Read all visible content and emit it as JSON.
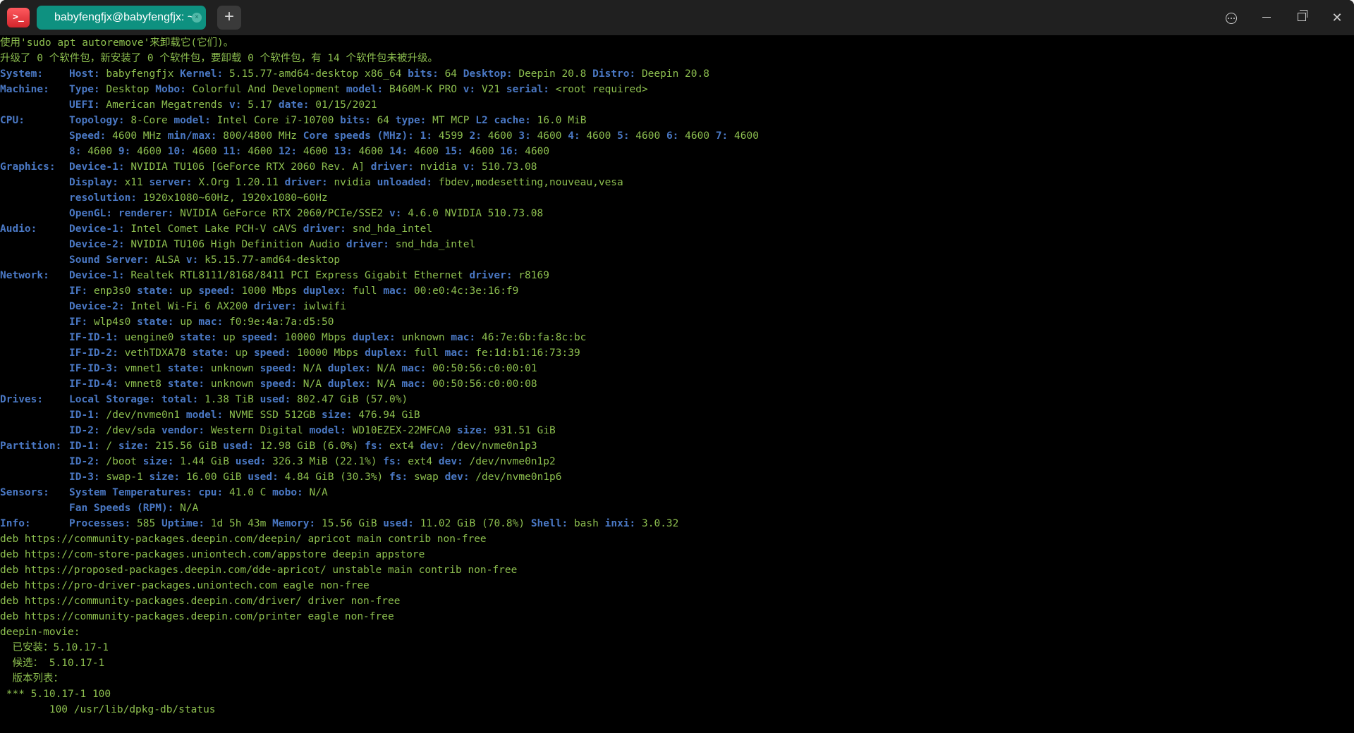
{
  "window": {
    "tab_title": "babyfengfjx@babyfengfjx: ~",
    "tab_close": "×",
    "new_tab": "+",
    "app_icon": ">_"
  },
  "terminal": {
    "pre": [
      "使用'sudo apt autoremove'来卸载它(它们)。",
      "升级了 0 个软件包，新安装了 0 个软件包，要卸载 0 个软件包，有 14 个软件包未被升级。"
    ],
    "sections": [
      {
        "label": "System:",
        "lines": [
          [
            [
              "Host:",
              "babyfengfjx"
            ],
            [
              "Kernel:",
              "5.15.77-amd64-desktop x86_64"
            ],
            [
              "bits:",
              "64"
            ],
            [
              "Desktop:",
              "Deepin 20.8"
            ],
            [
              "Distro:",
              "Deepin 20.8"
            ]
          ]
        ]
      },
      {
        "label": "Machine:",
        "lines": [
          [
            [
              "Type:",
              "Desktop"
            ],
            [
              "Mobo:",
              "Colorful And Development"
            ],
            [
              "model:",
              "B460M-K PRO"
            ],
            [
              "v:",
              "V21"
            ],
            [
              "serial:",
              "<root required>"
            ]
          ],
          [
            [
              "UEFI:",
              "American Megatrends"
            ],
            [
              "v:",
              "5.17"
            ],
            [
              "date:",
              "01/15/2021"
            ]
          ]
        ]
      },
      {
        "label": "CPU:",
        "lines": [
          [
            [
              "Topology:",
              "8-Core"
            ],
            [
              "model:",
              "Intel Core i7-10700"
            ],
            [
              "bits:",
              "64"
            ],
            [
              "type:",
              "MT MCP"
            ],
            [
              "L2 cache:",
              "16.0 MiB"
            ]
          ],
          [
            [
              "Speed:",
              "4600 MHz"
            ],
            [
              "min/max:",
              "800/4800 MHz"
            ],
            [
              "Core speeds (MHz):",
              ""
            ],
            [
              "1:",
              "4599"
            ],
            [
              "2:",
              "4600"
            ],
            [
              "3:",
              "4600"
            ],
            [
              "4:",
              "4600"
            ],
            [
              "5:",
              "4600"
            ],
            [
              "6:",
              "4600"
            ],
            [
              "7:",
              "4600"
            ]
          ],
          [
            [
              "8:",
              "4600"
            ],
            [
              "9:",
              "4600"
            ],
            [
              "10:",
              "4600"
            ],
            [
              "11:",
              "4600"
            ],
            [
              "12:",
              "4600"
            ],
            [
              "13:",
              "4600"
            ],
            [
              "14:",
              "4600"
            ],
            [
              "15:",
              "4600"
            ],
            [
              "16:",
              "4600"
            ]
          ]
        ]
      },
      {
        "label": "Graphics:",
        "lines": [
          [
            [
              "Device-1:",
              "NVIDIA TU106 [GeForce RTX 2060 Rev. A]"
            ],
            [
              "driver:",
              "nvidia"
            ],
            [
              "v:",
              "510.73.08"
            ]
          ],
          [
            [
              "Display:",
              "x11"
            ],
            [
              "server:",
              "X.Org 1.20.11"
            ],
            [
              "driver:",
              "nvidia"
            ],
            [
              "unloaded:",
              "fbdev,modesetting,nouveau,vesa"
            ]
          ],
          [
            [
              "resolution:",
              "1920x1080~60Hz, 1920x1080~60Hz"
            ]
          ],
          [
            [
              "OpenGL:",
              ""
            ],
            [
              "renderer:",
              "NVIDIA GeForce RTX 2060/PCIe/SSE2"
            ],
            [
              "v:",
              "4.6.0 NVIDIA 510.73.08"
            ]
          ]
        ]
      },
      {
        "label": "Audio:",
        "lines": [
          [
            [
              "Device-1:",
              "Intel Comet Lake PCH-V cAVS"
            ],
            [
              "driver:",
              "snd_hda_intel"
            ]
          ],
          [
            [
              "Device-2:",
              "NVIDIA TU106 High Definition Audio"
            ],
            [
              "driver:",
              "snd_hda_intel"
            ]
          ],
          [
            [
              "Sound Server:",
              "ALSA"
            ],
            [
              "v:",
              "k5.15.77-amd64-desktop"
            ]
          ]
        ]
      },
      {
        "label": "Network:",
        "lines": [
          [
            [
              "Device-1:",
              "Realtek RTL8111/8168/8411 PCI Express Gigabit Ethernet"
            ],
            [
              "driver:",
              "r8169"
            ]
          ],
          [
            [
              "IF:",
              "enp3s0"
            ],
            [
              "state:",
              "up"
            ],
            [
              "speed:",
              "1000 Mbps"
            ],
            [
              "duplex:",
              "full"
            ],
            [
              "mac:",
              "00:e0:4c:3e:16:f9"
            ]
          ],
          [
            [
              "Device-2:",
              "Intel Wi-Fi 6 AX200"
            ],
            [
              "driver:",
              "iwlwifi"
            ]
          ],
          [
            [
              "IF:",
              "wlp4s0"
            ],
            [
              "state:",
              "up"
            ],
            [
              "mac:",
              "f0:9e:4a:7a:d5:50"
            ]
          ],
          [
            [
              "IF-ID-1:",
              "uengine0"
            ],
            [
              "state:",
              "up"
            ],
            [
              "speed:",
              "10000 Mbps"
            ],
            [
              "duplex:",
              "unknown"
            ],
            [
              "mac:",
              "46:7e:6b:fa:8c:bc"
            ]
          ],
          [
            [
              "IF-ID-2:",
              "vethTDXA78"
            ],
            [
              "state:",
              "up"
            ],
            [
              "speed:",
              "10000 Mbps"
            ],
            [
              "duplex:",
              "full"
            ],
            [
              "mac:",
              "fe:1d:b1:16:73:39"
            ]
          ],
          [
            [
              "IF-ID-3:",
              "vmnet1"
            ],
            [
              "state:",
              "unknown"
            ],
            [
              "speed:",
              "N/A"
            ],
            [
              "duplex:",
              "N/A"
            ],
            [
              "mac:",
              "00:50:56:c0:00:01"
            ]
          ],
          [
            [
              "IF-ID-4:",
              "vmnet8"
            ],
            [
              "state:",
              "unknown"
            ],
            [
              "speed:",
              "N/A"
            ],
            [
              "duplex:",
              "N/A"
            ],
            [
              "mac:",
              "00:50:56:c0:00:08"
            ]
          ]
        ]
      },
      {
        "label": "Drives:",
        "lines": [
          [
            [
              "Local Storage:",
              ""
            ],
            [
              "total:",
              "1.38 TiB"
            ],
            [
              "used:",
              "802.47 GiB (57.0%)"
            ]
          ],
          [
            [
              "ID-1:",
              "/dev/nvme0n1"
            ],
            [
              "model:",
              "NVME SSD 512GB"
            ],
            [
              "size:",
              "476.94 GiB"
            ]
          ],
          [
            [
              "ID-2:",
              "/dev/sda"
            ],
            [
              "vendor:",
              "Western Digital"
            ],
            [
              "model:",
              "WD10EZEX-22MFCA0"
            ],
            [
              "size:",
              "931.51 GiB"
            ]
          ]
        ]
      },
      {
        "label": "Partition:",
        "lines": [
          [
            [
              "ID-1:",
              "/"
            ],
            [
              "size:",
              "215.56 GiB"
            ],
            [
              "used:",
              "12.98 GiB (6.0%)"
            ],
            [
              "fs:",
              "ext4"
            ],
            [
              "dev:",
              "/dev/nvme0n1p3"
            ]
          ],
          [
            [
              "ID-2:",
              "/boot"
            ],
            [
              "size:",
              "1.44 GiB"
            ],
            [
              "used:",
              "326.3 MiB (22.1%)"
            ],
            [
              "fs:",
              "ext4"
            ],
            [
              "dev:",
              "/dev/nvme0n1p2"
            ]
          ],
          [
            [
              "ID-3:",
              "swap-1"
            ],
            [
              "size:",
              "16.00 GiB"
            ],
            [
              "used:",
              "4.84 GiB (30.3%)"
            ],
            [
              "fs:",
              "swap"
            ],
            [
              "dev:",
              "/dev/nvme0n1p6"
            ]
          ]
        ]
      },
      {
        "label": "Sensors:",
        "lines": [
          [
            [
              "System Temperatures:",
              ""
            ],
            [
              "cpu:",
              "41.0 C"
            ],
            [
              "mobo:",
              "N/A"
            ]
          ],
          [
            [
              "Fan Speeds (RPM):",
              "N/A"
            ]
          ]
        ]
      },
      {
        "label": "Info:",
        "lines": [
          [
            [
              "Processes:",
              "585"
            ],
            [
              "Uptime:",
              "1d 5h 43m"
            ],
            [
              "Memory:",
              "15.56 GiB"
            ],
            [
              "used:",
              "11.02 GiB (70.8%)"
            ],
            [
              "Shell:",
              "bash"
            ],
            [
              "inxi:",
              "3.0.32"
            ]
          ]
        ]
      }
    ],
    "post": [
      "deb https://community-packages.deepin.com/deepin/ apricot main contrib non-free",
      "deb https://com-store-packages.uniontech.com/appstore deepin appstore",
      "deb https://proposed-packages.deepin.com/dde-apricot/ unstable main contrib non-free",
      "deb https://pro-driver-packages.uniontech.com eagle non-free",
      "deb https://community-packages.deepin.com/driver/ driver non-free",
      "deb https://community-packages.deepin.com/printer eagle non-free",
      "deepin-movie:",
      "  已安装：5.10.17-1",
      "  候选： 5.10.17-1",
      "  版本列表：",
      " *** 5.10.17-1 100",
      "        100 /usr/lib/dpkg-db/status"
    ]
  }
}
